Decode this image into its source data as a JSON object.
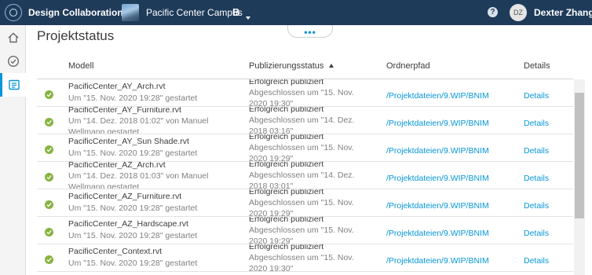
{
  "header": {
    "app_name": "Design Collaboration",
    "project_name": "Pacific Center Campus",
    "project_badge": "B",
    "help_label": "?",
    "user_initials": "DZ",
    "user_name": "Dexter Zhang"
  },
  "rail": {
    "items": [
      "home-icon",
      "check-circle-icon",
      "document-list-icon"
    ],
    "active_index": 2
  },
  "collapse_tab": {
    "label": "•••"
  },
  "page": {
    "title": "Projektstatus"
  },
  "table": {
    "columns": {
      "model": "Modell",
      "status": "Publizierungsstatus",
      "path": "Ordnerpfad",
      "details": "Details"
    },
    "sorted_column": "status",
    "sort_direction": "ascending",
    "rows": [
      {
        "name": "PacificCenter_AY_Arch.rvt",
        "started": "Um \"15. Nov. 2020 19:28\" gestartet",
        "started2": "",
        "status": "Erfolgreich publiziert",
        "completed": "Abgeschlossen um \"15. Nov.",
        "completed2": "2020 19:30\"",
        "path": "/Projektdateien/9.WIP/BNIM",
        "details": "Details"
      },
      {
        "name": "PacificCenter_AY_Furniture.rvt",
        "started": "Um \"14. Dez. 2018 01:02\" von Manuel",
        "started2": "Wellmann gestartet",
        "status": "Erfolgreich publiziert",
        "completed": "Abgeschlossen um \"14. Dez.",
        "completed2": "2018 03:16\"",
        "path": "/Projektdateien/9.WIP/BNIM",
        "details": "Details"
      },
      {
        "name": "PacificCenter_AY_Sun Shade.rvt",
        "started": "Um \"15. Nov. 2020 19:28\" gestartet",
        "started2": "",
        "status": "Erfolgreich publiziert",
        "completed": "Abgeschlossen um \"15. Nov.",
        "completed2": "2020 19:29\"",
        "path": "/Projektdateien/9.WIP/BNIM",
        "details": "Details"
      },
      {
        "name": "PacificCenter_AZ_Arch.rvt",
        "started": "Um \"14. Dez. 2018 01:03\" von Manuel",
        "started2": "Wellmann gestartet",
        "status": "Erfolgreich publiziert",
        "completed": "Abgeschlossen um \"14. Dez.",
        "completed2": "2018 03:01\"",
        "path": "/Projektdateien/9.WIP/BNIM",
        "details": "Details"
      },
      {
        "name": "PacificCenter_AZ_Furniture.rvt",
        "started": "Um \"15. Nov. 2020 19:28\" gestartet",
        "started2": "",
        "status": "Erfolgreich publiziert",
        "completed": "Abgeschlossen um \"15. Nov.",
        "completed2": "2020 19:29\"",
        "path": "/Projektdateien/9.WIP/BNIM",
        "details": "Details"
      },
      {
        "name": "PacificCenter_AZ_Hardscape.rvt",
        "started": "Um \"15. Nov. 2020 19:28\" gestartet",
        "started2": "",
        "status": "Erfolgreich publiziert",
        "completed": "Abgeschlossen um \"15. Nov.",
        "completed2": "2020 19:29\"",
        "path": "/Projektdateien/9.WIP/BNIM",
        "details": "Details"
      },
      {
        "name": "PacificCenter_Context.rvt",
        "started": "Um \"15. Nov. 2020 19:28\" gestartet",
        "started2": "",
        "status": "Erfolgreich publiziert",
        "completed": "Abgeschlossen um \"15. Nov.",
        "completed2": "2020 19:30\"",
        "path": "/Projektdateien/9.WIP/BNIM",
        "details": "Details"
      }
    ]
  },
  "colors": {
    "header_bg": "#1f3b5a",
    "accent": "#0696d7",
    "success": "#87b340"
  }
}
